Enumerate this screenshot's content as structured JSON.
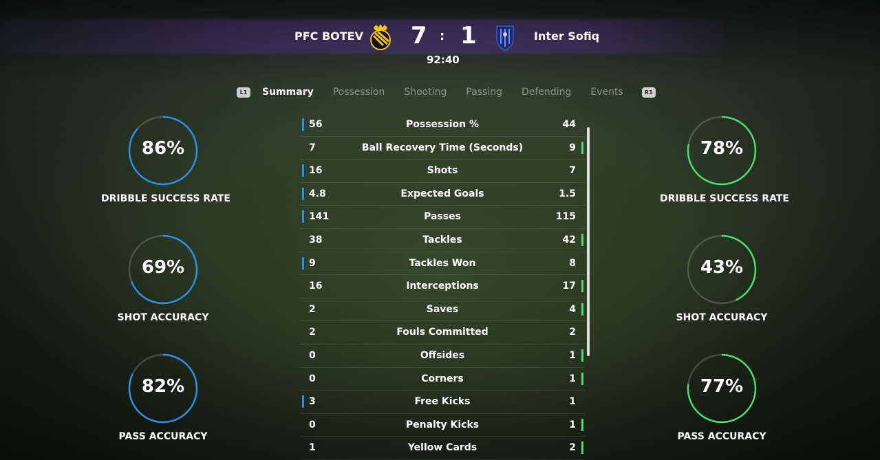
{
  "match": {
    "home_team": "PFC BOTEV",
    "away_team": "Inter Sofiq",
    "home_score": "7",
    "away_score": "1",
    "separator": ":",
    "clock": "92:40"
  },
  "colors": {
    "home_accent": "#2b8fe8",
    "away_accent": "#4cdc6c"
  },
  "tabs": {
    "left_button": "L1",
    "right_button": "R1",
    "items": [
      {
        "label": "Summary",
        "active": true
      },
      {
        "label": "Possession",
        "active": false
      },
      {
        "label": "Shooting",
        "active": false
      },
      {
        "label": "Passing",
        "active": false
      },
      {
        "label": "Defending",
        "active": false
      },
      {
        "label": "Events",
        "active": false
      }
    ]
  },
  "home_circles": [
    {
      "value": "86%",
      "fraction": 0.86,
      "label": "DRIBBLE SUCCESS RATE"
    },
    {
      "value": "69%",
      "fraction": 0.69,
      "label": "SHOT ACCURACY"
    },
    {
      "value": "82%",
      "fraction": 0.82,
      "label": "PASS ACCURACY"
    }
  ],
  "away_circles": [
    {
      "value": "78%",
      "fraction": 0.78,
      "label": "DRIBBLE SUCCESS RATE"
    },
    {
      "value": "43%",
      "fraction": 0.43,
      "label": "SHOT ACCURACY"
    },
    {
      "value": "77%",
      "fraction": 0.77,
      "label": "PASS ACCURACY"
    }
  ],
  "stats": [
    {
      "home": "56",
      "label": "Possession %",
      "away": "44",
      "leader": "home"
    },
    {
      "home": "7",
      "label": "Ball Recovery Time (Seconds)",
      "away": "9",
      "leader": "away"
    },
    {
      "home": "16",
      "label": "Shots",
      "away": "7",
      "leader": "home"
    },
    {
      "home": "4.8",
      "label": "Expected Goals",
      "away": "1.5",
      "leader": "home"
    },
    {
      "home": "141",
      "label": "Passes",
      "away": "115",
      "leader": "home"
    },
    {
      "home": "38",
      "label": "Tackles",
      "away": "42",
      "leader": "away"
    },
    {
      "home": "9",
      "label": "Tackles Won",
      "away": "8",
      "leader": "home"
    },
    {
      "home": "16",
      "label": "Interceptions",
      "away": "17",
      "leader": "away"
    },
    {
      "home": "2",
      "label": "Saves",
      "away": "4",
      "leader": "away"
    },
    {
      "home": "2",
      "label": "Fouls Committed",
      "away": "2",
      "leader": "none"
    },
    {
      "home": "0",
      "label": "Offsides",
      "away": "1",
      "leader": "away"
    },
    {
      "home": "0",
      "label": "Corners",
      "away": "1",
      "leader": "away"
    },
    {
      "home": "3",
      "label": "Free Kicks",
      "away": "1",
      "leader": "home"
    },
    {
      "home": "0",
      "label": "Penalty Kicks",
      "away": "1",
      "leader": "away"
    },
    {
      "home": "1",
      "label": "Yellow Cards",
      "away": "2",
      "leader": "away"
    }
  ]
}
